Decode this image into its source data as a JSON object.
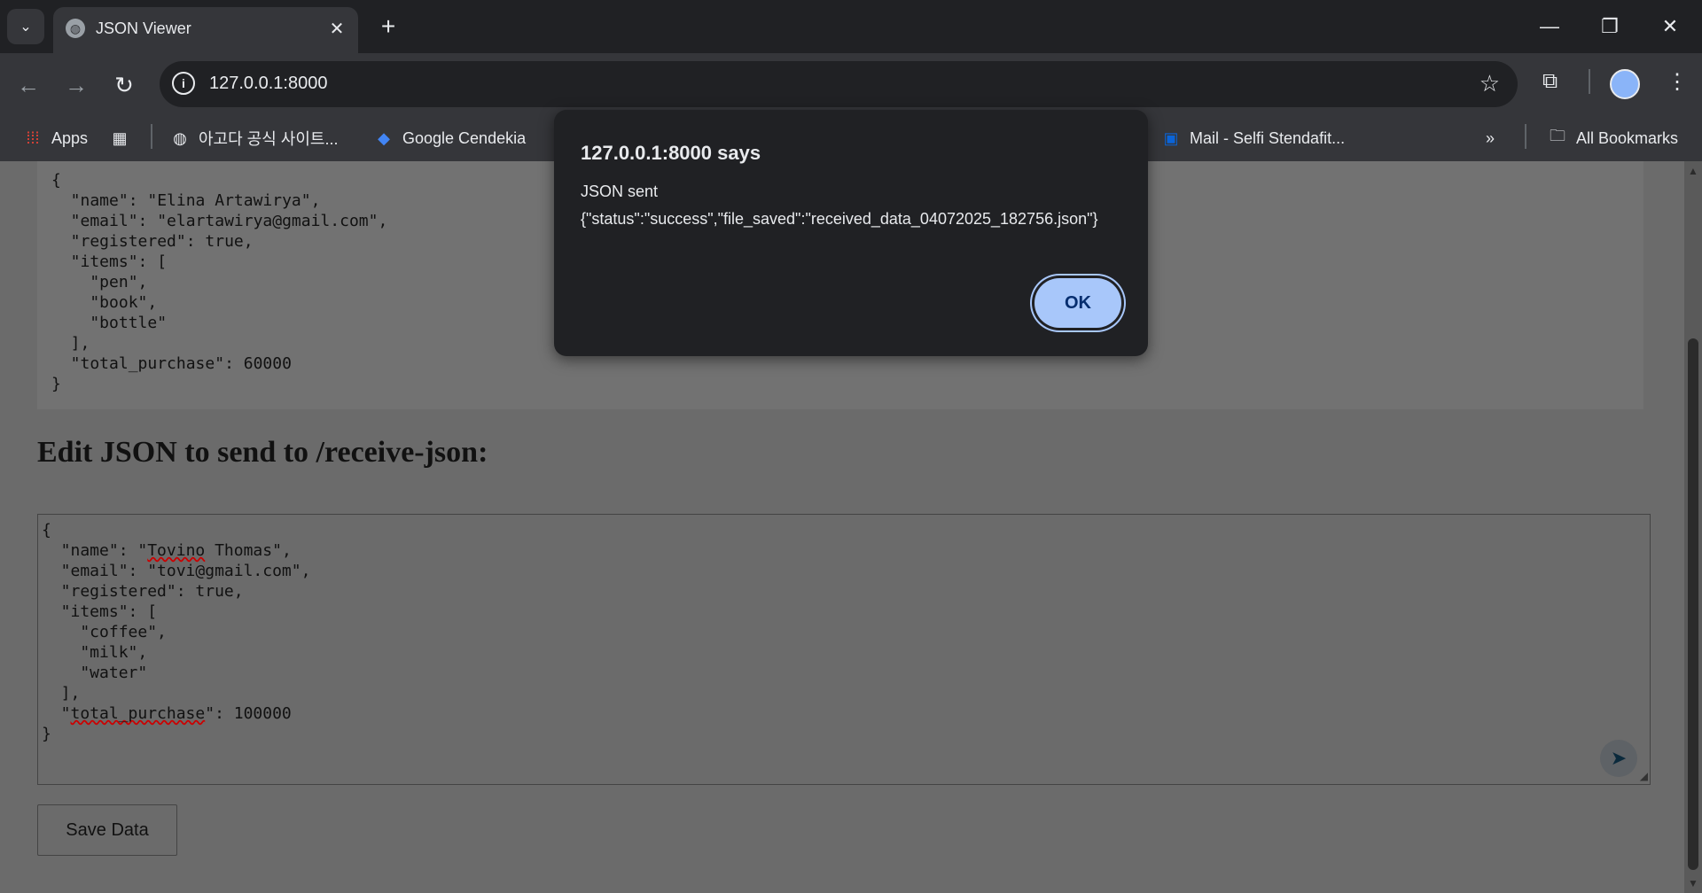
{
  "browser": {
    "tab_title": "JSON Viewer",
    "url": "127.0.0.1:8000",
    "bookmarks": [
      {
        "label": "Apps",
        "icon": "apps-grid-icon"
      },
      {
        "label": "",
        "icon": "tab-groups-icon"
      },
      {
        "label": "아고다 공식 사이트...",
        "icon": "globe-icon"
      },
      {
        "label": "Google Cendekia",
        "icon": "scholar-icon"
      },
      {
        "label": "Mail - Selfi Stendafit...",
        "icon": "outlook-icon"
      }
    ],
    "all_bookmarks": "All Bookmarks"
  },
  "page": {
    "received_json": "{\n  \"name\": \"Elina Artawirya\",\n  \"email\": \"elartawirya@gmail.com\",\n  \"registered\": true,\n  \"items\": [\n    \"pen\",\n    \"book\",\n    \"bottle\"\n  ],\n  \"total_purchase\": 60000\n}",
    "heading": "Edit JSON to send to /receive-json:",
    "editor": {
      "line1": "{",
      "name_pre": "  \"name\": \"",
      "name_sq": "Tovino",
      "name_post": " Thomas\",",
      "line3": "  \"email\": \"tovi@gmail.com\",",
      "line4": "  \"registered\": true,",
      "line5": "  \"items\": [",
      "line6": "    \"coffee\",",
      "line7": "    \"milk\",",
      "line8": "    \"water\"",
      "line9": "  ],",
      "tp_pre": "  \"",
      "tp_sq": "total_purchase",
      "tp_post": "\": 100000",
      "line11": "}"
    },
    "save_button": "Save Data"
  },
  "dialog": {
    "title": "127.0.0.1:8000 says",
    "message_line1": "JSON sent",
    "message_line2": "{\"status\":\"success\",\"file_saved\":\"received_data_04072025_182756.json\"}",
    "ok_label": "OK",
    "ok_color": "#a8c7fa"
  }
}
